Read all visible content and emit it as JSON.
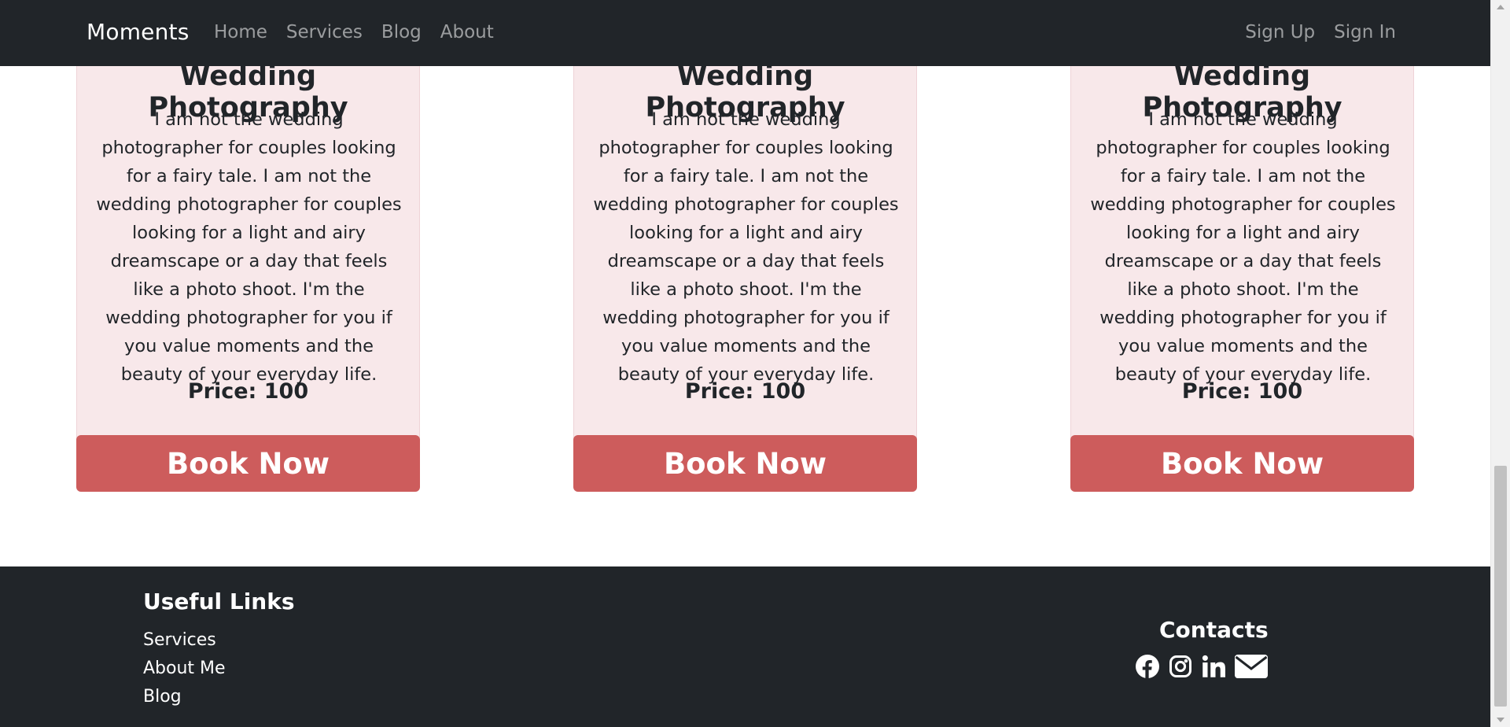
{
  "navbar": {
    "brand": "Moments",
    "links": [
      "Home",
      "Services",
      "Blog",
      "About"
    ],
    "auth": [
      "Sign Up",
      "Sign In"
    ]
  },
  "cards": [
    {
      "title": "Wedding Photography",
      "text": "I am not the wedding photographer for couples looking for a fairy tale. I am not the wedding photographer for couples looking for a light and airy dreamscape or a day that feels like a photo shoot. I'm the wedding photographer for you if you value moments and the beauty of your everyday life.",
      "price": "Price: 100",
      "button": "Book Now"
    },
    {
      "title": "Wedding Photography",
      "text": "I am not the wedding photographer for couples looking for a fairy tale. I am not the wedding photographer for couples looking for a light and airy dreamscape or a day that feels like a photo shoot. I'm the wedding photographer for you if you value moments and the beauty of your everyday life.",
      "price": "Price: 100",
      "button": "Book Now"
    },
    {
      "title": "Wedding Photography",
      "text": "I am not the wedding photographer for couples looking for a fairy tale. I am not the wedding photographer for couples looking for a light and airy dreamscape or a day that feels like a photo shoot. I'm the wedding photographer for you if you value moments and the beauty of your everyday life.",
      "price": "Price: 100",
      "button": "Book Now"
    }
  ],
  "footer": {
    "useful_links_heading": "Useful Links",
    "links": [
      "Services",
      "About Me",
      "Blog"
    ],
    "contacts_heading": "Contacts",
    "social_icons": [
      "facebook-icon",
      "instagram-icon",
      "linkedin-icon",
      "envelope-icon"
    ]
  },
  "colors": {
    "navbar_bg": "#212529",
    "card_bg": "#f8e8ea",
    "button_bg": "#cd5c5c",
    "footer_bg": "#212529"
  }
}
